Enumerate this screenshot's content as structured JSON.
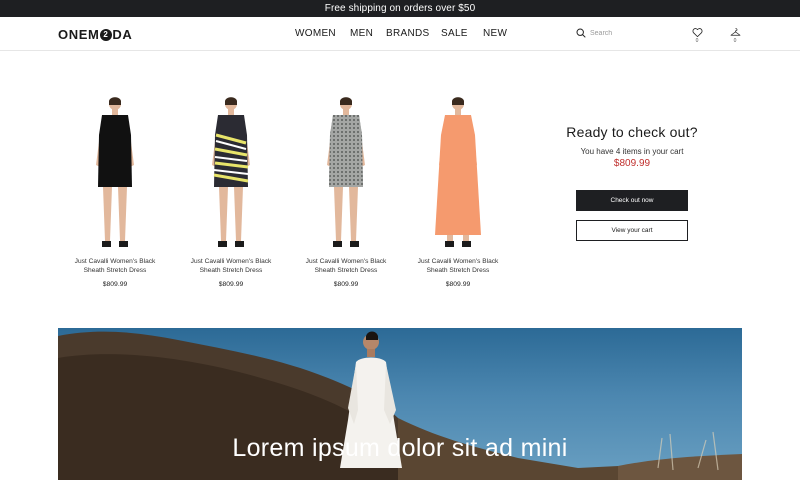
{
  "announcement": "Free shipping on orders over $50",
  "header": {
    "logo": {
      "prefix": "ONEM",
      "circle": "2",
      "suffix": "DA"
    },
    "nav": [
      "WOMEN",
      "MEN",
      "BRANDS",
      "SALE",
      "NEW"
    ],
    "search_placeholder": "Search",
    "wishlist_count": "0",
    "cart_count": "0"
  },
  "products": [
    {
      "name": "Just Cavalli Women's Black Sheath Stretch Dress",
      "price": "$809.99",
      "dress_color": "#111111"
    },
    {
      "name": "Just Cavalli Women's Black Sheath Stretch Dress",
      "price": "$809.99",
      "dress_color": "#2b2b33"
    },
    {
      "name": "Just Cavalli Women's Black Sheath Stretch Dress",
      "price": "$809.99",
      "dress_color": "#8f9290"
    },
    {
      "name": "Just Cavalli Women's Black Sheath Stretch Dress",
      "price": "$809.99",
      "dress_color": "#f59a6e"
    }
  ],
  "checkout": {
    "title": "Ready to check out?",
    "info": "You have 4 items in your cart",
    "total": "$809.99",
    "primary_button": "Check out now",
    "secondary_button": "View your cart"
  },
  "hero": {
    "headline": "Lorem ipsum dolor sit ad mini"
  },
  "colors": {
    "dark": "#1e1f22",
    "accent_price": "#c0302e"
  }
}
